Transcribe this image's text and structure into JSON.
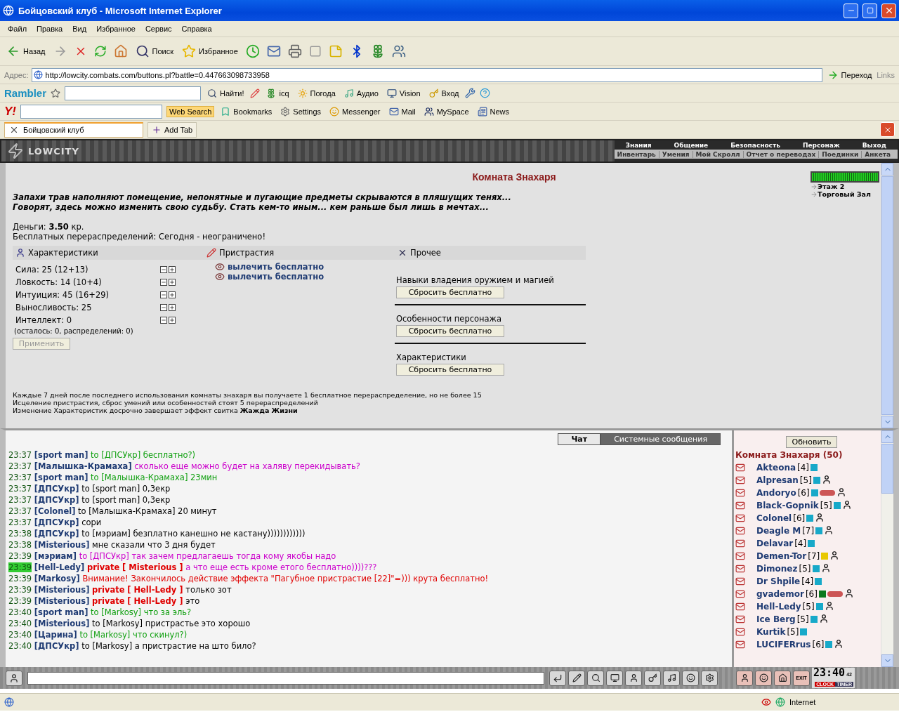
{
  "window": {
    "title": "Бойцовский клуб - Microsoft Internet Explorer"
  },
  "menu": [
    "Файл",
    "Правка",
    "Вид",
    "Избранное",
    "Сервис",
    "Справка"
  ],
  "toolbar": [
    {
      "kind": "back",
      "label": "Назад"
    },
    {
      "kind": "search",
      "label": "Поиск"
    },
    {
      "kind": "favorites",
      "label": "Избранное"
    }
  ],
  "address": {
    "label": "Адрес:",
    "url": "http://lowcity.combats.com/buttons.pl?battle=0.447663098733958",
    "go": "Переход",
    "links": "Links"
  },
  "rambler": {
    "logo": "Rambler",
    "search_button": "Найти!",
    "items": [
      {
        "kind": "icq",
        "label": "icq"
      },
      {
        "kind": "weather",
        "label": "Погода"
      },
      {
        "kind": "audio",
        "label": "Аудио"
      },
      {
        "kind": "vision",
        "label": "Vision"
      },
      {
        "kind": "login",
        "label": "Вход"
      }
    ]
  },
  "yahoo": {
    "logo": "Y!",
    "search_button": "Web Search",
    "items": [
      {
        "kind": "bookmarks",
        "label": "Bookmarks"
      },
      {
        "kind": "settings",
        "label": "Settings"
      },
      {
        "kind": "messenger",
        "label": "Messenger"
      },
      {
        "kind": "mail",
        "label": "Mail"
      },
      {
        "kind": "myspace",
        "label": "MySpace"
      },
      {
        "kind": "news",
        "label": "News"
      }
    ]
  },
  "tab": {
    "label": "Бойцовский клуб"
  },
  "add_tab": "Add Tab",
  "game": {
    "logo": "LOWCITY",
    "nav_top": [
      "Знания",
      "Общение",
      "Безопасность",
      "Персонаж",
      "Выход"
    ],
    "nav_bottom": [
      "Инвентарь",
      "Умения",
      "Мой Скролл",
      "Отчет о переводах",
      "Поединки",
      "Анкета"
    ]
  },
  "room": {
    "title": "Комната Знахаря",
    "description": [
      "Запахи трав наполняют помещение, непонятные и пугающие предметы скрываются в пляшущих тенях...",
      "Говорят, здесь можно изменить свою судьбу. Стать кем-то иным... кем раньше был лишь в мечтах..."
    ],
    "money": "Деньги: **3.50** кр.",
    "free": "Бесплатных перераспределений: Сегодня - неограничено!",
    "location": [
      "Этаж 2",
      "Торговый Зал"
    ],
    "stats": {
      "heading": "Характеристики",
      "items": [
        "Сила: 25 (12+13)",
        "Ловкость: 14 (10+4)",
        "Интуиция: 45 (16+29)",
        "Выносливость: 25",
        "Интеллект: 0"
      ],
      "note": "(осталось: 0, распределений: 0)",
      "apply": {
        "label": "Применить",
        "disabled": true
      }
    },
    "addictions": {
      "heading": "Пристрастия",
      "links": [
        "вылечить бесплатно",
        "вылечить бесплатно"
      ]
    },
    "other": {
      "heading": "Прочее",
      "groups": [
        {
          "label": "Навыки владения оружием и магией",
          "button": "Сбросить бесплатно"
        },
        {
          "label": "Особенности персонажа",
          "button": "Сбросить бесплатно"
        },
        {
          "label": "Характеристики",
          "button": "Сбросить бесплатно"
        }
      ]
    },
    "footer": [
      "Каждые 7 дней после последнего использования комнаты знахаря вы получаете 1 бесплатное перераспределение, но не более 15",
      "Исцеление пристрастия, сброс умений или особенностей стоят 5 перераспределений",
      "Изменение Характеристик досрочно завершает эффект свитка **Жажда Жизни**"
    ]
  },
  "chat": {
    "tabs": [
      {
        "label": "Чат",
        "selected": true
      },
      {
        "label": "Системные сообщения",
        "selected": false
      }
    ],
    "messages": [
      {
        "time": "23:37",
        "highlighted": false,
        "sender": "[sport man]",
        "kind": "public",
        "text": "to [ДПСУкр] бесплатно?)",
        "color": "#11a011"
      },
      {
        "time": "23:37",
        "highlighted": false,
        "sender": "[Малышка-Крамаха]",
        "kind": "public",
        "text": "сколько еще можно будет на халяву перекидывать?",
        "color": "#cc00cc"
      },
      {
        "time": "23:37",
        "highlighted": false,
        "sender": "[sport man]",
        "kind": "public",
        "text": "to [Малышка-Крамаха] 23мин",
        "color": "#11a011"
      },
      {
        "time": "23:37",
        "highlighted": false,
        "sender": "[ДПСУкр]",
        "kind": "public",
        "text": "to [sport man] 0,3екр",
        "color": "#000000"
      },
      {
        "time": "23:37",
        "highlighted": false,
        "sender": "[ДПСУкр]",
        "kind": "public",
        "text": "to [sport man] 0,3екр",
        "color": "#000000"
      },
      {
        "time": "23:37",
        "highlighted": false,
        "sender": "[Colonel]",
        "kind": "public",
        "text": "to [Малышка-Крамаха] 20 минут",
        "color": "#000000"
      },
      {
        "time": "23:37",
        "highlighted": false,
        "sender": "[ДПСУкр]",
        "kind": "public",
        "text": "сори",
        "color": "#000000"
      },
      {
        "time": "23:38",
        "highlighted": false,
        "sender": "[ДПСУкр]",
        "kind": "public",
        "text": "to [мэриам] безплатно канешно не кастану))))))))))))",
        "color": "#000000"
      },
      {
        "time": "23:38",
        "highlighted": false,
        "sender": "[Misterious]",
        "kind": "public",
        "text": "мне сказали что 3 дня будет",
        "color": "#000000"
      },
      {
        "time": "23:39",
        "highlighted": false,
        "sender": "[мэриам]",
        "kind": "public",
        "text": "to [ДПСУкр] так зачем предлагаешь тогда кому якобы надо",
        "color": "#cc00cc"
      },
      {
        "time": "23:39",
        "highlighted": true,
        "sender": "[Hell-Ledy]",
        "kind": "private",
        "private_label": "private",
        "recipient": "[ Misterious ]",
        "text": "а что еще есть кроме етого бесплатно))))???",
        "color": "#cc00cc"
      },
      {
        "time": "23:39",
        "highlighted": false,
        "sender": "[Markosy]",
        "kind": "public",
        "text": "Внимание! Закончилось действие эффекта \"Пагубное пристрастие [22]\"=))) крута бесплатно!",
        "color": "#e00000"
      },
      {
        "time": "23:39",
        "highlighted": false,
        "sender": "[Misterious]",
        "kind": "private",
        "private_label": "private",
        "recipient": "[ Hell-Ledy ]",
        "text": "только зот",
        "color": "#000000"
      },
      {
        "time": "23:39",
        "highlighted": false,
        "sender": "[Misterious]",
        "kind": "private",
        "private_label": "private",
        "recipient": "[ Hell-Ledy ]",
        "text": "это",
        "color": "#000000"
      },
      {
        "time": "23:40",
        "highlighted": false,
        "sender": "[sport man]",
        "kind": "public",
        "text": "to [Markosy] что за эль?",
        "color": "#11a011"
      },
      {
        "time": "23:40",
        "highlighted": false,
        "sender": "[Misterious]",
        "kind": "public",
        "text": "to [Markosy] пристрастье это хорошо",
        "color": "#000000"
      },
      {
        "time": "23:40",
        "highlighted": false,
        "sender": "[Царина]",
        "kind": "public",
        "text": "to [Markosy] что скинул?)",
        "color": "#11a011"
      },
      {
        "time": "23:40",
        "highlighted": false,
        "sender": "[ДПСУкр]",
        "kind": "public",
        "text": "to [Markosy] а пристрастие на што било?",
        "color": "#000000"
      }
    ],
    "refresh": "Обновить",
    "room_title": "Комната Знахаря (50)",
    "users": [
      {
        "name": "Akteona",
        "rank": "[4]",
        "color": "#17a9c9",
        "lips": false,
        "medic": false
      },
      {
        "name": "Alpresan",
        "rank": "[5]",
        "color": "#17a9c9",
        "lips": false,
        "medic": true
      },
      {
        "name": "Andoryo",
        "rank": "[6]",
        "color": "#17a9c9",
        "lips": true,
        "medic": true
      },
      {
        "name": "Black-Gopnik",
        "rank": "[5]",
        "color": "#17a9c9",
        "lips": false,
        "medic": true
      },
      {
        "name": "Colonel",
        "rank": "[6]",
        "color": "#17a9c9",
        "lips": false,
        "medic": true
      },
      {
        "name": "Deagle M",
        "rank": "[7]",
        "color": "#17a9c9",
        "lips": false,
        "medic": true
      },
      {
        "name": "Delavar",
        "rank": "[4]",
        "color": "#17a9c9",
        "lips": false,
        "medic": false
      },
      {
        "name": "Demen-Tor",
        "rank": "[7]",
        "color": "#e8c800",
        "lips": false,
        "medic": true
      },
      {
        "name": "Dimonez",
        "rank": "[5]",
        "color": "#17a9c9",
        "lips": false,
        "medic": true
      },
      {
        "name": "Dr Shpile",
        "rank": "[4]",
        "color": "#17a9c9",
        "lips": false,
        "medic": false
      },
      {
        "name": "gvademor",
        "rank": "[6]",
        "color": "#0c7a1e",
        "lips": true,
        "medic": true
      },
      {
        "name": "Hell-Ledy",
        "rank": "[5]",
        "color": "#17a9c9",
        "lips": false,
        "medic": true
      },
      {
        "name": "Ice Berg",
        "rank": "[5]",
        "color": "#17a9c9",
        "lips": false,
        "medic": true
      },
      {
        "name": "Kurtik",
        "rank": "[5]",
        "color": "#17a9c9",
        "lips": false,
        "medic": false
      },
      {
        "name": "LUCIFERrus",
        "rank": "[6]",
        "color": "#17a9c9",
        "lips": false,
        "medic": true
      }
    ]
  },
  "bottom": {
    "exit": "EXIT",
    "clock": "23:40",
    "seconds": "42",
    "clock_label": "CLOCK",
    "timer_label": "TIMER"
  },
  "status": {
    "zone": "Internet"
  }
}
